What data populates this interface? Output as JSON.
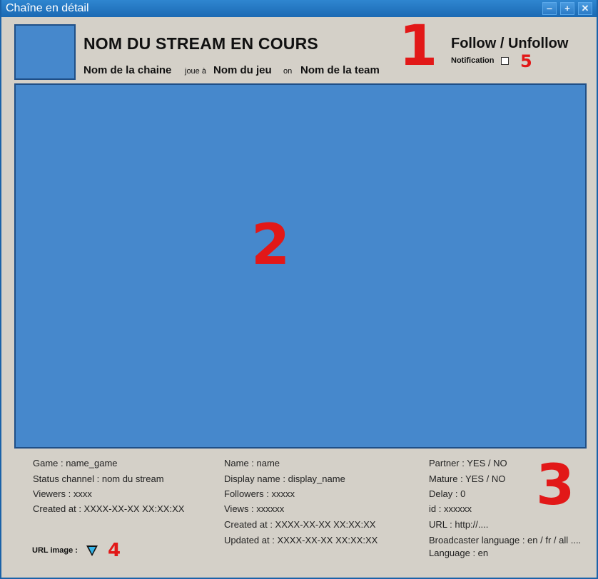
{
  "window": {
    "title": "Chaîne en détail",
    "buttons": {
      "minimize": "‒",
      "maximize": "+",
      "close": "✕"
    }
  },
  "header": {
    "stream_title": "NOM DU STREAM EN COURS",
    "channel_name": "Nom de la chaine",
    "plays_word": "joue à",
    "game_name": "Nom du jeu",
    "on_word": "on",
    "team_name": "Nom de la team",
    "follow_label": "Follow / Unfollow",
    "notification_label": "Notification"
  },
  "markers": {
    "m1": "1",
    "m2": "2",
    "m3": "3",
    "m4": "4",
    "m5": "5"
  },
  "info": {
    "col1": [
      "Game : name_game",
      "Status channel : nom du stream",
      "Viewers : xxxx",
      "Created at : XXXX-XX-XX XX:XX:XX"
    ],
    "col2": [
      "Name : name",
      "Display name : display_name",
      "Followers : xxxxx",
      "Views : xxxxxx",
      "Created at : XXXX-XX-XX XX:XX:XX",
      "Updated at : XXXX-XX-XX XX:XX:XX"
    ],
    "col3": [
      "Partner : YES / NO",
      "Mature : YES / NO",
      "Delay : 0",
      "id : xxxxxx",
      "URL : http://....",
      "Broadcaster language : en / fr / all ....",
      "Language : en"
    ],
    "url_image_label": "URL image :"
  },
  "colors": {
    "accent": "#4688cc",
    "titlebar": "#1f6fb4",
    "marker": "#e21818",
    "background": "#d4d0c8"
  }
}
